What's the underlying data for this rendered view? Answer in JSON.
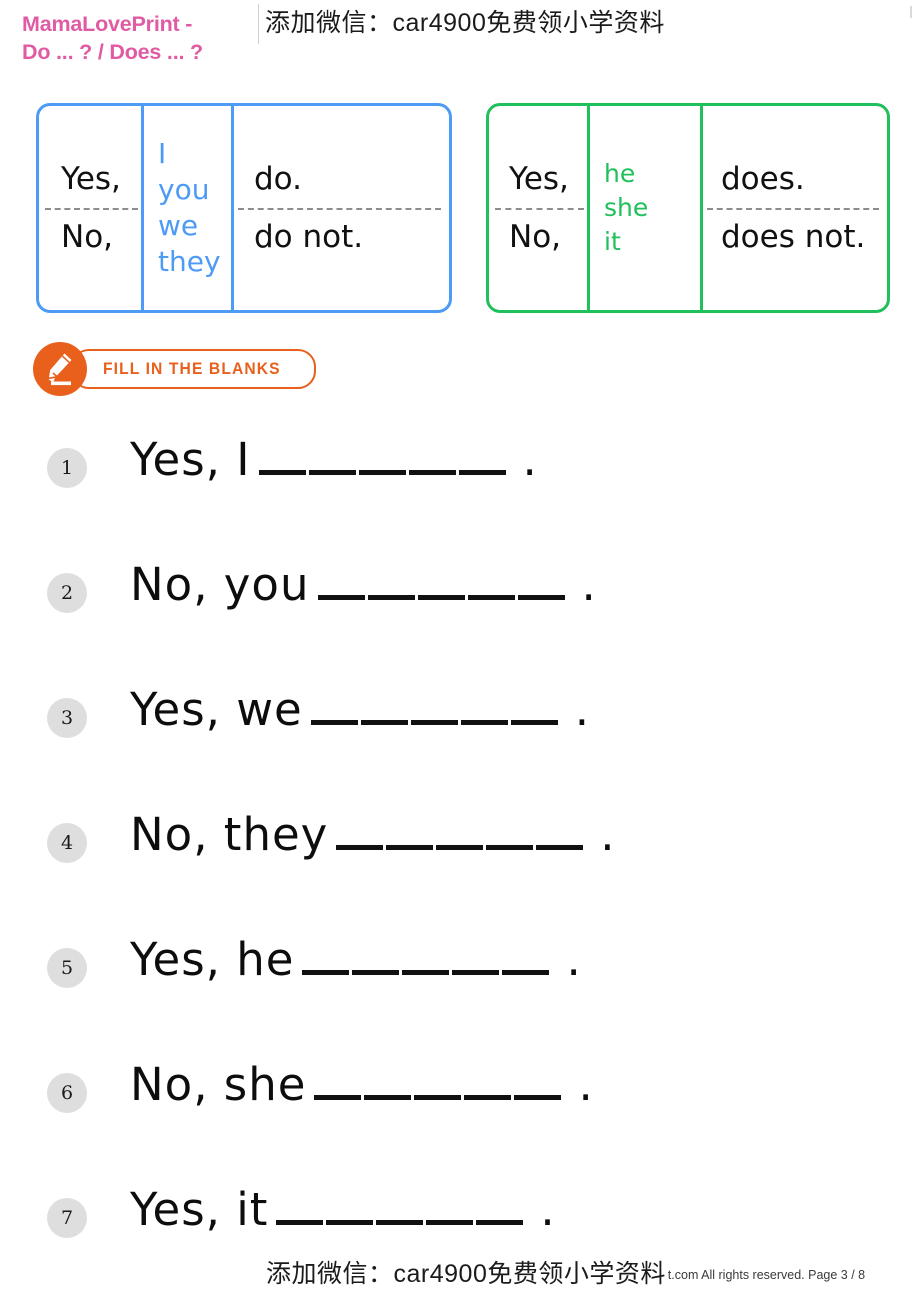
{
  "header": {
    "brand_line1": "MamaLovePrint -",
    "brand_line2": "Do ... ? / Does ... ?",
    "watermark": "添加微信：car4900免费领小学资料",
    "brand_color": "#e05ba4"
  },
  "tables": [
    {
      "id": "do-table",
      "accent_color": "#4d9bf5",
      "rows": [
        {
          "answer": "Yes,",
          "verb": "do."
        },
        {
          "answer": "No,",
          "verb": "do not."
        }
      ],
      "pronouns": [
        "I",
        "you",
        "we",
        "they"
      ]
    },
    {
      "id": "does-table",
      "accent_color": "#20c05c",
      "rows": [
        {
          "answer": "Yes,",
          "verb": "does."
        },
        {
          "answer": "No,",
          "verb": "does not."
        }
      ],
      "pronouns": [
        "he",
        "she",
        "it"
      ]
    }
  ],
  "badge": {
    "label": "FILL IN THE BLANKS",
    "color": "#e8601c",
    "icon": "pencil-icon"
  },
  "exercises": [
    {
      "number": "1",
      "lead": "Yes, I",
      "period": "."
    },
    {
      "number": "2",
      "lead": "No, you",
      "period": "."
    },
    {
      "number": "3",
      "lead": "Yes, we",
      "period": "."
    },
    {
      "number": "4",
      "lead": "No, they",
      "period": "."
    },
    {
      "number": "5",
      "lead": "Yes, he",
      "period": "."
    },
    {
      "number": "6",
      "lead": "No, she",
      "period": "."
    },
    {
      "number": "7",
      "lead": "Yes, it",
      "period": "."
    }
  ],
  "footer": {
    "copyright": "eprint.com All rights reserved. Page 3 / 8",
    "watermark": "添加微信：car4900免费领小学资料"
  }
}
